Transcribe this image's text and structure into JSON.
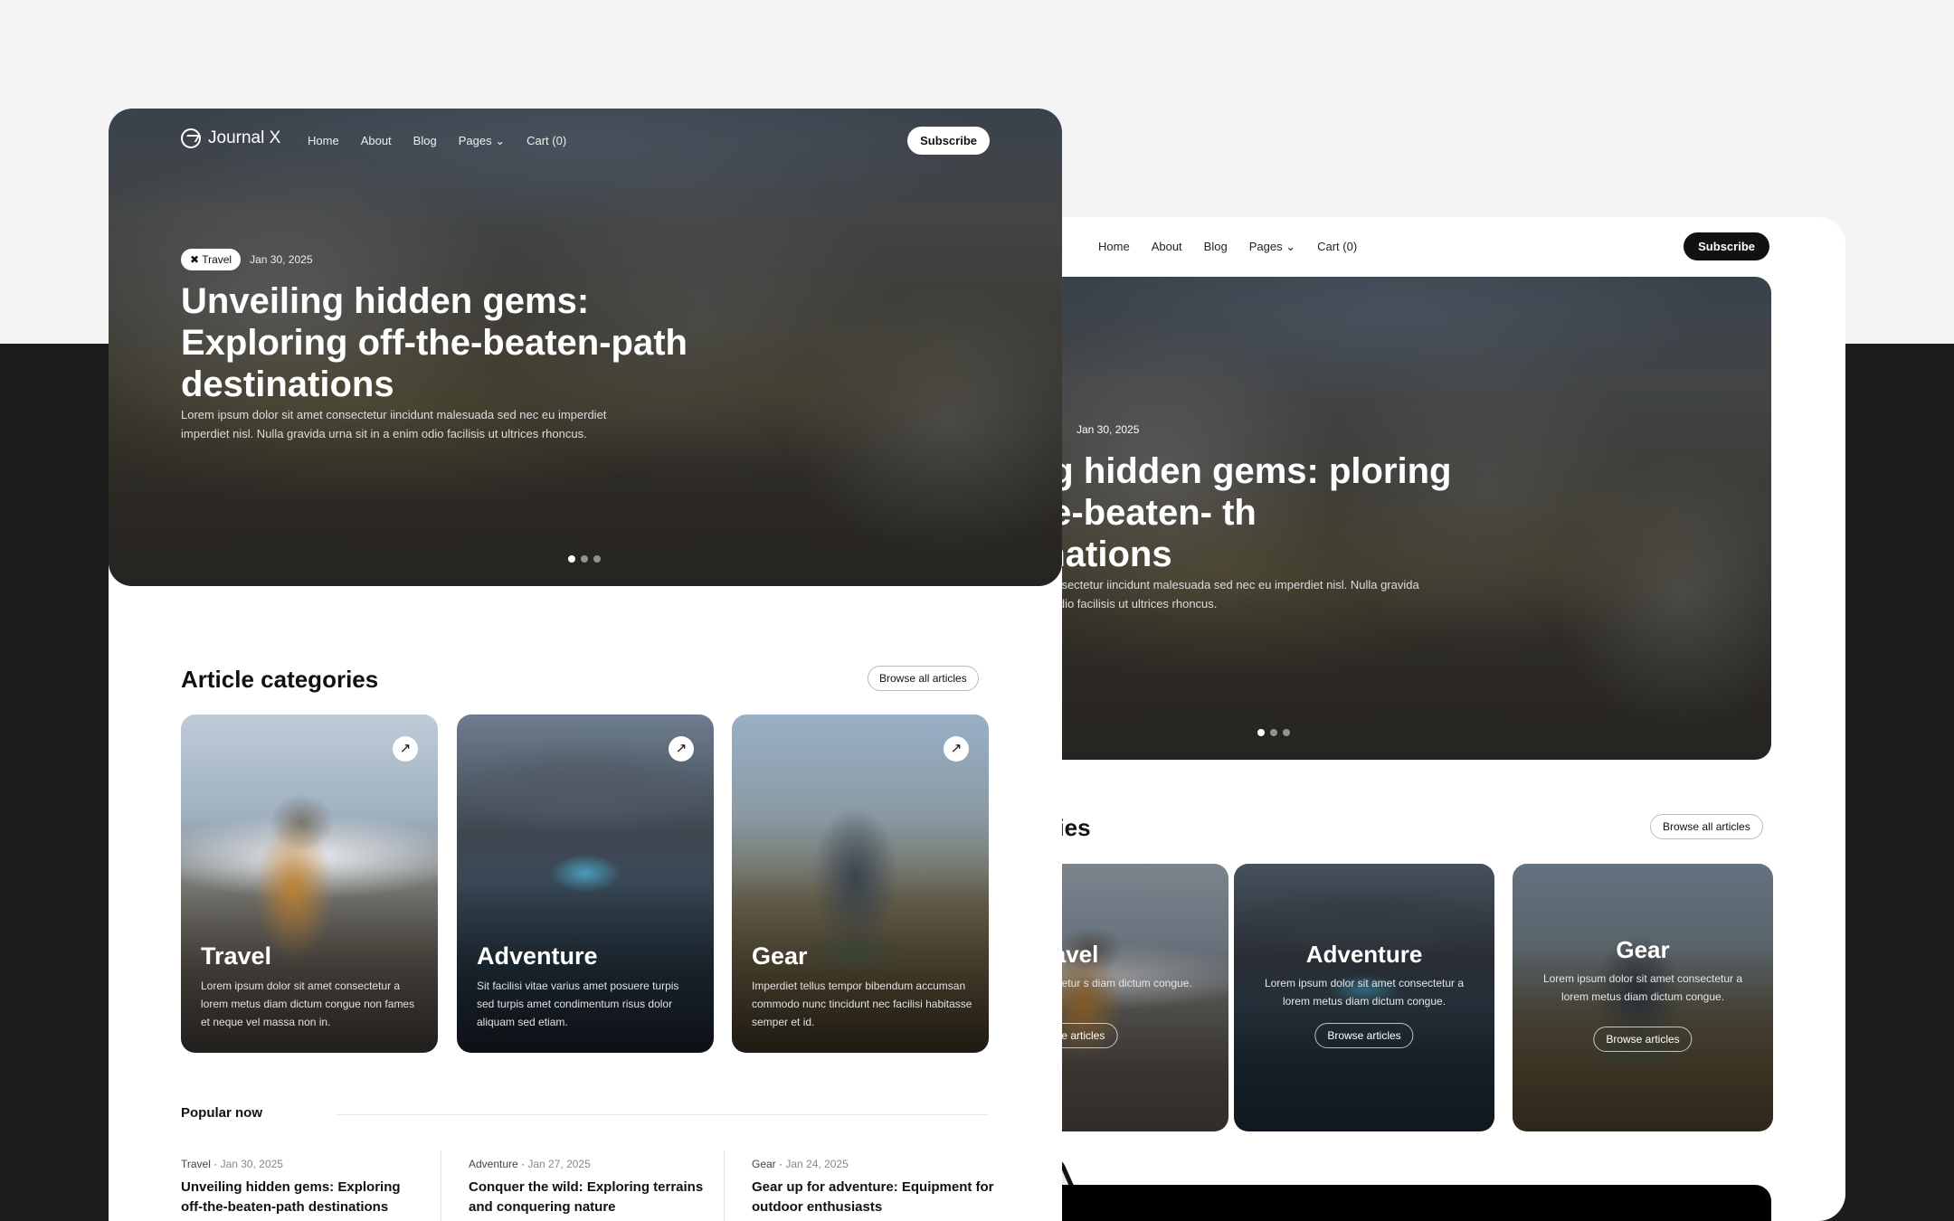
{
  "brand": {
    "name": "Journal X",
    "short": "X"
  },
  "nav": {
    "links": [
      "Home",
      "About",
      "Blog",
      "Pages",
      "Cart (0)"
    ],
    "subscribe": "Subscribe"
  },
  "hero": {
    "tag": "Travel",
    "date": "Jan 30, 2025",
    "title": "Unveiling hidden gems: Exploring off-the-beaten-path destinations",
    "body": "Lorem ipsum dolor sit amet consectetur iincidunt malesuada sed nec eu imperdiet imperdiet nisl. Nulla gravida urna sit in a enim odio facilisis ut ultrices rhoncus."
  },
  "back_hero": {
    "title": "veiling hidden gems: ploring off-the-beaten- th destinations",
    "body": "n dolor sit amet consectetur iincidunt malesuada sed nec eu imperdiet nisl. Nulla gravida urna sit in a enim odio facilisis ut ultrices rhoncus."
  },
  "categories": {
    "title": "Article categories",
    "title_cropped": "ategories",
    "browse": "Browse all articles",
    "items": [
      {
        "name": "Travel",
        "desc": "Lorem ipsum dolor sit amet consectetur a lorem metus diam dictum congue non fames et neque vel massa non in."
      },
      {
        "name": "Adventure",
        "desc": "Sit facilisi vitae varius amet posuere turpis sed turpis amet condimentum risus dolor aliquam sed etiam."
      },
      {
        "name": "Gear",
        "desc": "Imperdiet tellus tempor bibendum accumsan commodo nunc tincidunt nec facilisi habitasse semper et id."
      }
    ],
    "back_items": [
      {
        "name": "ravel",
        "desc": "lor sit amet consectetur s diam dictum congue.",
        "btn": "wse articles"
      },
      {
        "name": "Adventure",
        "desc": "Lorem ipsum dolor sit amet consectetur a lorem metus diam dictum congue.",
        "btn": "Browse articles"
      },
      {
        "name": "Gear",
        "desc": "Lorem ipsum dolor sit amet consectetur a lorem metus diam dictum congue.",
        "btn": "Browse articles"
      }
    ]
  },
  "popular": {
    "title": "Popular now",
    "posts": [
      {
        "category": "Travel",
        "date": "Jan 30, 2025",
        "title": "Unveiling hidden gems: Exploring off-the-beaten-path destinations"
      },
      {
        "category": "Adventure",
        "date": "Jan 27, 2025",
        "title": "Conquer the wild: Exploring terrains and conquering nature"
      },
      {
        "category": "Gear",
        "date": "Jan 24, 2025",
        "title": "Gear up for adventure: Equipment for outdoor enthusiasts"
      }
    ]
  },
  "colors": {
    "page_bg": "#f4f4f4",
    "dark_band": "#1c1c1c",
    "accent": "#111111"
  }
}
